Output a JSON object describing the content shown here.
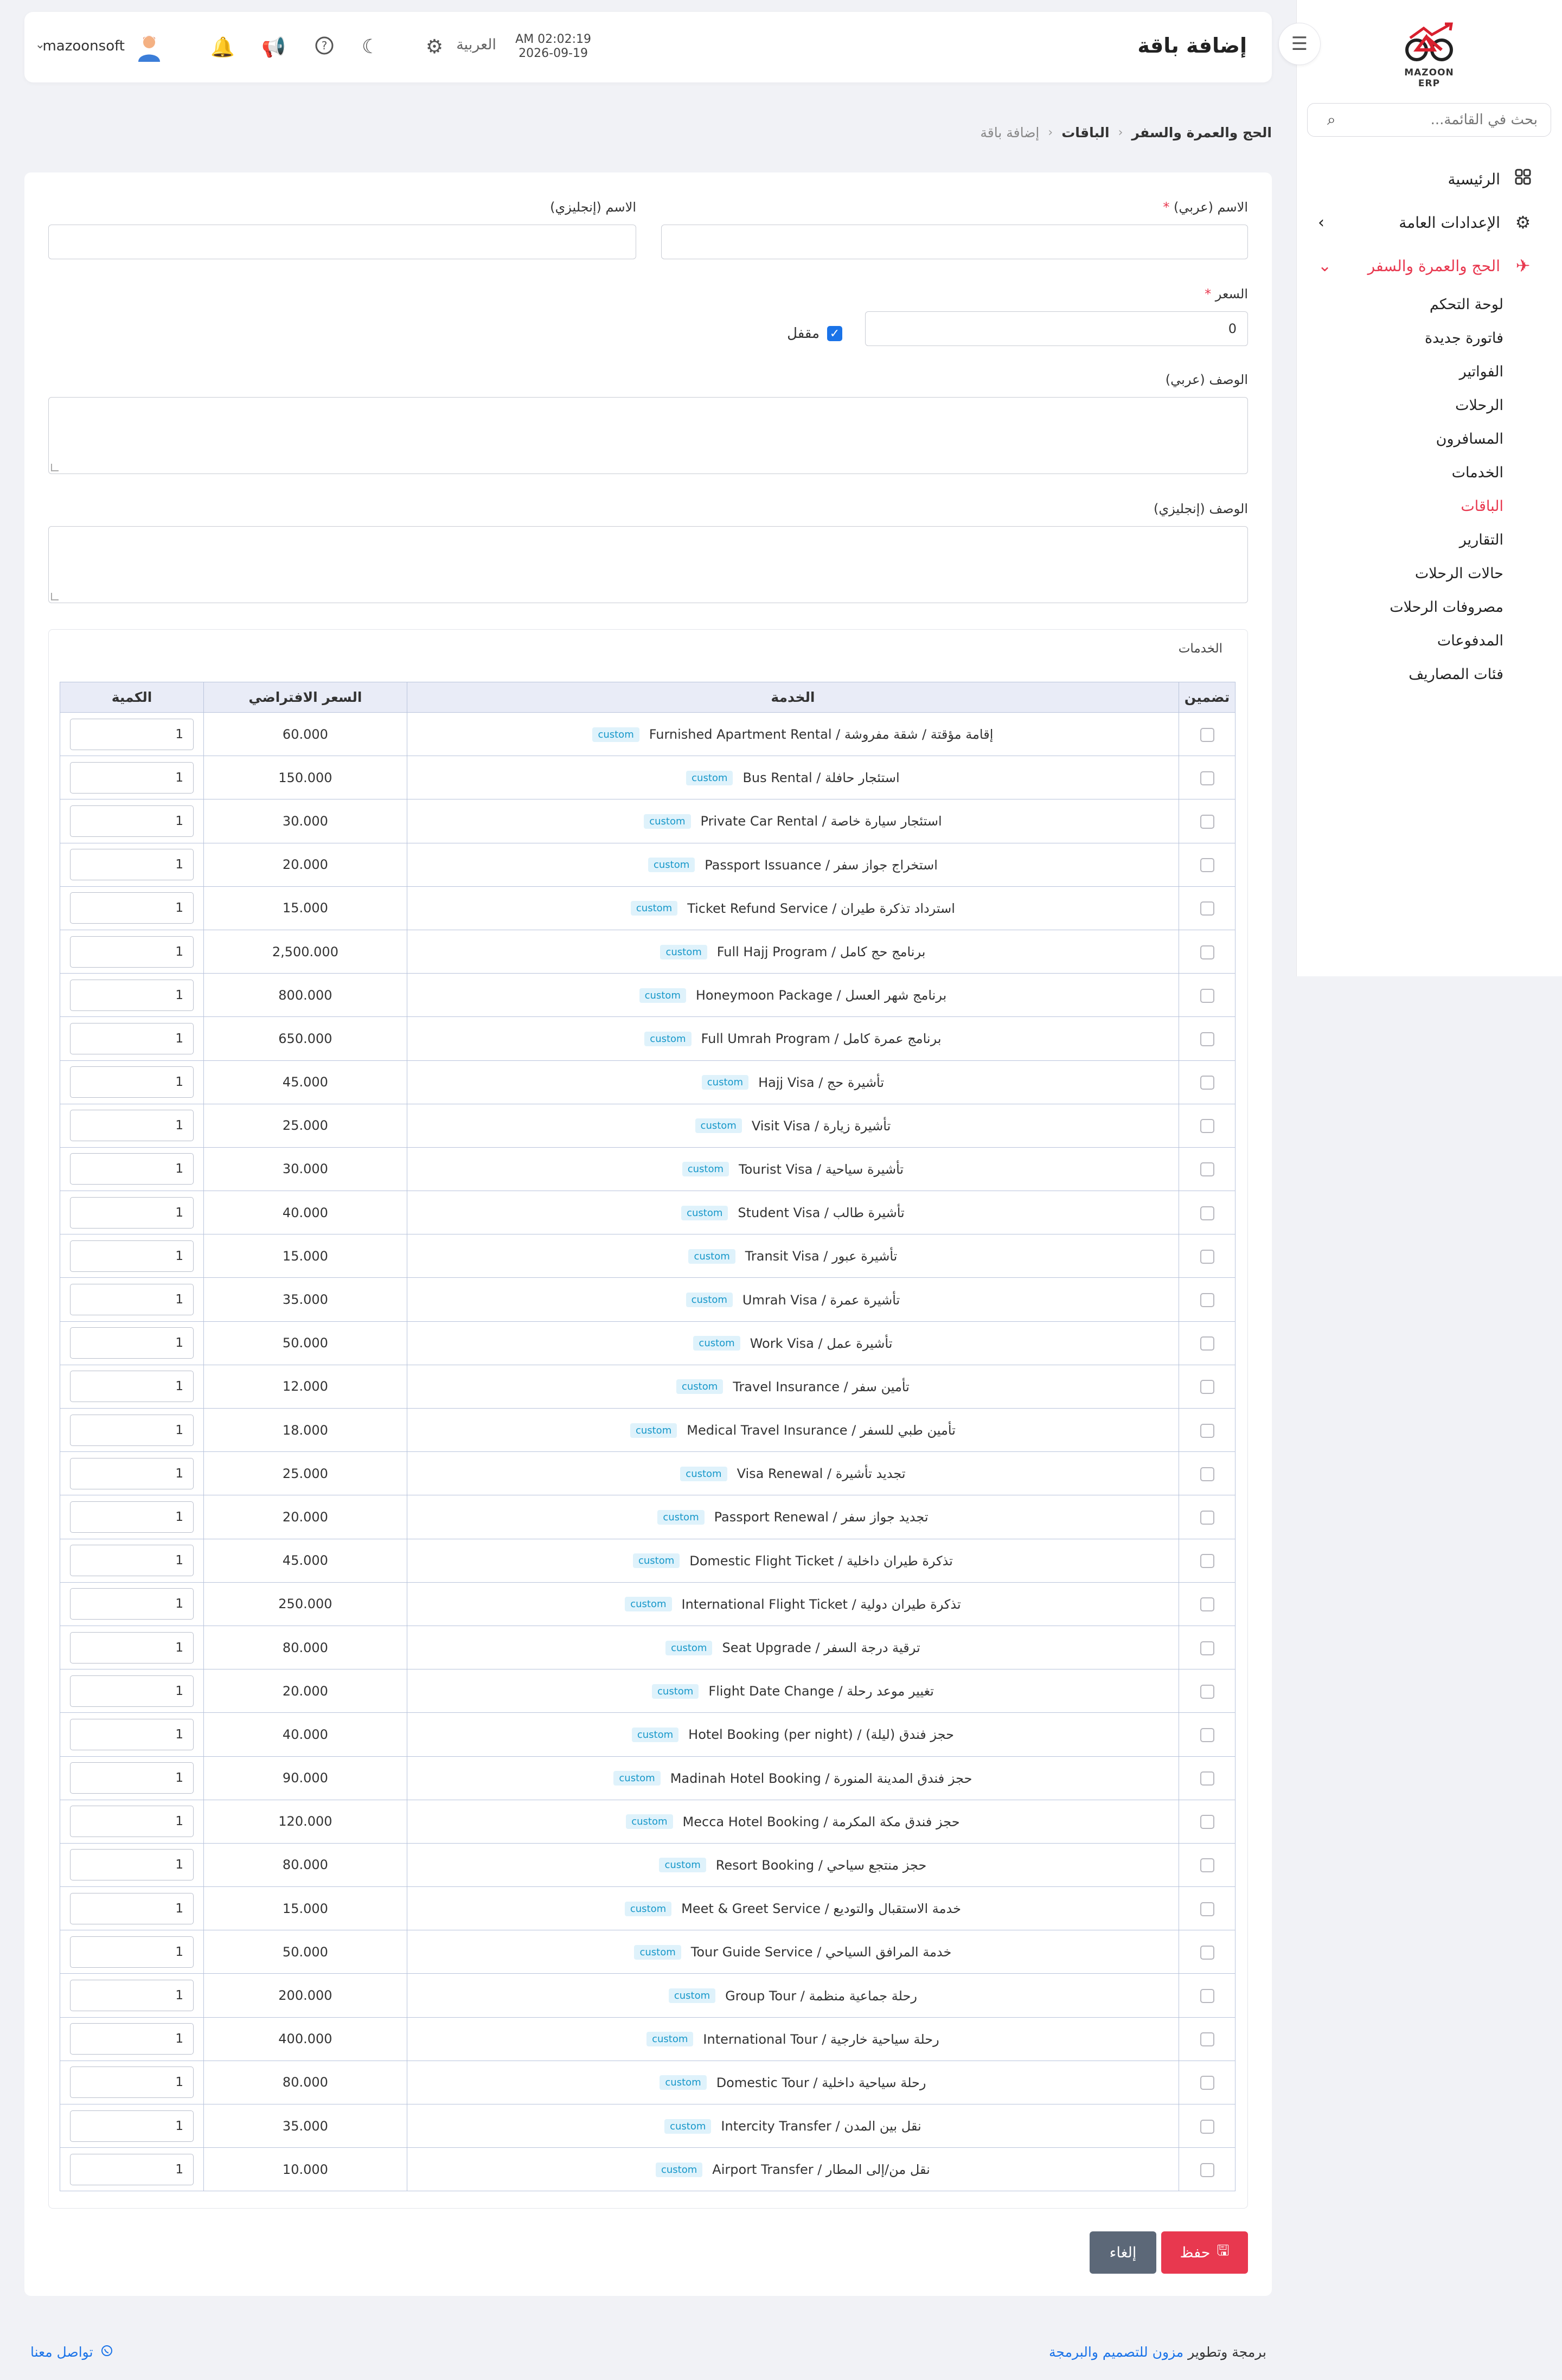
{
  "app": {
    "logo_text": "MAZOON ERP",
    "page_title": "إضافة باقة",
    "clock_time": "AM 02:02:19",
    "clock_date": "2026-09-19",
    "language": "العربية",
    "username": "mazoonsoft"
  },
  "sidebar": {
    "search_placeholder": "بحث في القائمة...",
    "items": [
      {
        "label": "الرئيسية",
        "icon": "grid-icon"
      },
      {
        "label": "الإعدادات العامة",
        "icon": "gear-icon"
      },
      {
        "label": "الحج والعمرة والسفر",
        "icon": "plane-icon"
      }
    ],
    "subitems": [
      "لوحة التحكم",
      "فاتورة جديدة",
      "الفواتير",
      "الرحلات",
      "المسافرون",
      "الخدمات",
      "الباقات",
      "التقارير",
      "حالات الرحلات",
      "مصروفات الرحلات",
      "المدفوعات",
      "فئات المصاريف"
    ]
  },
  "breadcrumb": {
    "level1": "الحج والعمرة والسفر",
    "level2": "الباقات",
    "level3": "إضافة باقة"
  },
  "form": {
    "name_ar_label": "الاسم (عربي)",
    "name_en_label": "الاسم (إنجليزي)",
    "price_label": "السعر",
    "price_value": "0",
    "locked_label": "مقفل",
    "desc_ar_label": "الوصف (عربي)",
    "desc_en_label": "الوصف (إنجليزي)",
    "required_mark": "*"
  },
  "services": {
    "title": "الخدمات",
    "headers": {
      "include": "تضمين",
      "service": "الخدمة",
      "price": "السعر الافتراضي",
      "qty": "الكمية"
    },
    "badge": "custom",
    "rows": [
      {
        "name": "إقامة مؤقتة / شقة مفروشة / Furnished Apartment Rental",
        "price": "60.000",
        "qty": "1"
      },
      {
        "name": "استئجار حافلة / Bus Rental",
        "price": "150.000",
        "qty": "1"
      },
      {
        "name": "استئجار سيارة خاصة / Private Car Rental",
        "price": "30.000",
        "qty": "1"
      },
      {
        "name": "استخراج جواز سفر / Passport Issuance",
        "price": "20.000",
        "qty": "1"
      },
      {
        "name": "استرداد تذكرة طيران / Ticket Refund Service",
        "price": "15.000",
        "qty": "1"
      },
      {
        "name": "برنامج حج كامل / Full Hajj Program",
        "price": "2,500.000",
        "qty": "1"
      },
      {
        "name": "برنامج شهر العسل / Honeymoon Package",
        "price": "800.000",
        "qty": "1"
      },
      {
        "name": "برنامج عمرة كامل / Full Umrah Program",
        "price": "650.000",
        "qty": "1"
      },
      {
        "name": "تأشيرة حج / Hajj Visa",
        "price": "45.000",
        "qty": "1"
      },
      {
        "name": "تأشيرة زيارة / Visit Visa",
        "price": "25.000",
        "qty": "1"
      },
      {
        "name": "تأشيرة سياحية / Tourist Visa",
        "price": "30.000",
        "qty": "1"
      },
      {
        "name": "تأشيرة طالب / Student Visa",
        "price": "40.000",
        "qty": "1"
      },
      {
        "name": "تأشيرة عبور / Transit Visa",
        "price": "15.000",
        "qty": "1"
      },
      {
        "name": "تأشيرة عمرة / Umrah Visa",
        "price": "35.000",
        "qty": "1"
      },
      {
        "name": "تأشيرة عمل / Work Visa",
        "price": "50.000",
        "qty": "1"
      },
      {
        "name": "تأمين سفر / Travel Insurance",
        "price": "12.000",
        "qty": "1"
      },
      {
        "name": "تأمين طبي للسفر / Medical Travel Insurance",
        "price": "18.000",
        "qty": "1"
      },
      {
        "name": "تجديد تأشيرة / Visa Renewal",
        "price": "25.000",
        "qty": "1"
      },
      {
        "name": "تجديد جواز سفر / Passport Renewal",
        "price": "20.000",
        "qty": "1"
      },
      {
        "name": "تذكرة طيران داخلية / Domestic Flight Ticket",
        "price": "45.000",
        "qty": "1"
      },
      {
        "name": "تذكرة طيران دولية / International Flight Ticket",
        "price": "250.000",
        "qty": "1"
      },
      {
        "name": "ترقية درجة السفر / Seat Upgrade",
        "price": "80.000",
        "qty": "1"
      },
      {
        "name": "تغيير موعد رحلة / Flight Date Change",
        "price": "20.000",
        "qty": "1"
      },
      {
        "name": "حجز فندق (ليلة) / Hotel Booking (per night)",
        "price": "40.000",
        "qty": "1"
      },
      {
        "name": "حجز فندق المدينة المنورة / Madinah Hotel Booking",
        "price": "90.000",
        "qty": "1"
      },
      {
        "name": "حجز فندق مكة المكرمة / Mecca Hotel Booking",
        "price": "120.000",
        "qty": "1"
      },
      {
        "name": "حجز منتجع سياحي / Resort Booking",
        "price": "80.000",
        "qty": "1"
      },
      {
        "name": "خدمة الاستقبال والتوديع / Meet & Greet Service",
        "price": "15.000",
        "qty": "1"
      },
      {
        "name": "خدمة المرافق السياحي / Tour Guide Service",
        "price": "50.000",
        "qty": "1"
      },
      {
        "name": "رحلة جماعية منظمة / Group Tour",
        "price": "200.000",
        "qty": "1"
      },
      {
        "name": "رحلة سياحية خارجية / International Tour",
        "price": "400.000",
        "qty": "1"
      },
      {
        "name": "رحلة سياحية داخلية / Domestic Tour",
        "price": "80.000",
        "qty": "1"
      },
      {
        "name": "نقل بين المدن / Intercity Transfer",
        "price": "35.000",
        "qty": "1"
      },
      {
        "name": "نقل من/إلى المطار / Airport Transfer",
        "price": "10.000",
        "qty": "1"
      }
    ]
  },
  "actions": {
    "save_label": "حفظ",
    "cancel_label": "إلغاء"
  },
  "footer": {
    "credit_prefix": "برمجة وتطوير",
    "credit_brand": "مزون للتصميم والبرمجة",
    "contact_label": "تواصل معنا"
  },
  "colors": {
    "accent": "#e8384f",
    "primary": "#1a73e8",
    "badge_bg": "#dff2fb",
    "badge_text": "#1597c9"
  }
}
